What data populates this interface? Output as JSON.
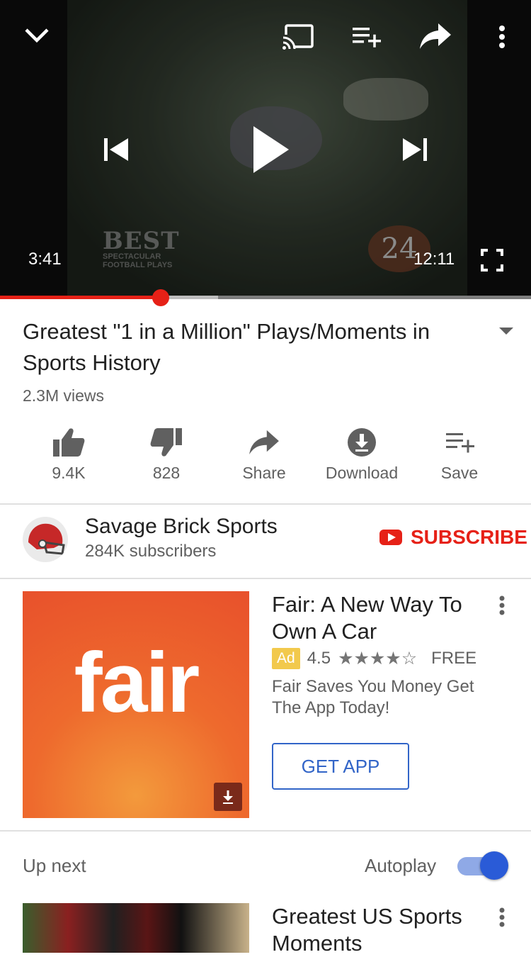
{
  "player": {
    "current_time": "3:41",
    "duration": "12:11",
    "progress_fraction": 0.302,
    "buffered_fraction": 0.41,
    "watermark_line1": "BEST",
    "watermark_line2": "SPECTACULAR",
    "watermark_line3": "FOOTBALL PLAYS",
    "overlay_number": "24"
  },
  "video": {
    "title": "Greatest \"1 in a Million\" Plays/Moments in Sports History",
    "views": "2.3M views"
  },
  "actions": [
    {
      "label": "9.4K",
      "icon": "thumbs-up-icon"
    },
    {
      "label": "828",
      "icon": "thumbs-down-icon"
    },
    {
      "label": "Share",
      "icon": "share-icon"
    },
    {
      "label": "Download",
      "icon": "download-icon"
    },
    {
      "label": "Save",
      "icon": "playlist-add-icon"
    }
  ],
  "channel": {
    "name": "Savage Brick Sports",
    "subscribers": "284K subscribers",
    "subscribe_label": "SUBSCRIBE"
  },
  "ad": {
    "logo_text": "fair",
    "title": "Fair: A New Way To Own A Car",
    "badge": "Ad",
    "rating": "4.5",
    "stars": "★★★★☆",
    "price": "FREE",
    "description": "Fair Saves You Money Get The App Today!",
    "cta": "GET APP"
  },
  "upnext": {
    "label": "Up next",
    "autoplay_label": "Autoplay",
    "autoplay_on": true,
    "next_title": "Greatest US Sports Moments"
  },
  "colors": {
    "accent_red": "#e62117",
    "link_blue": "#3265c8",
    "toggle_blue": "#2a5bd7",
    "ad_orange": "#e8512c",
    "ad_badge": "#f2c94c"
  }
}
